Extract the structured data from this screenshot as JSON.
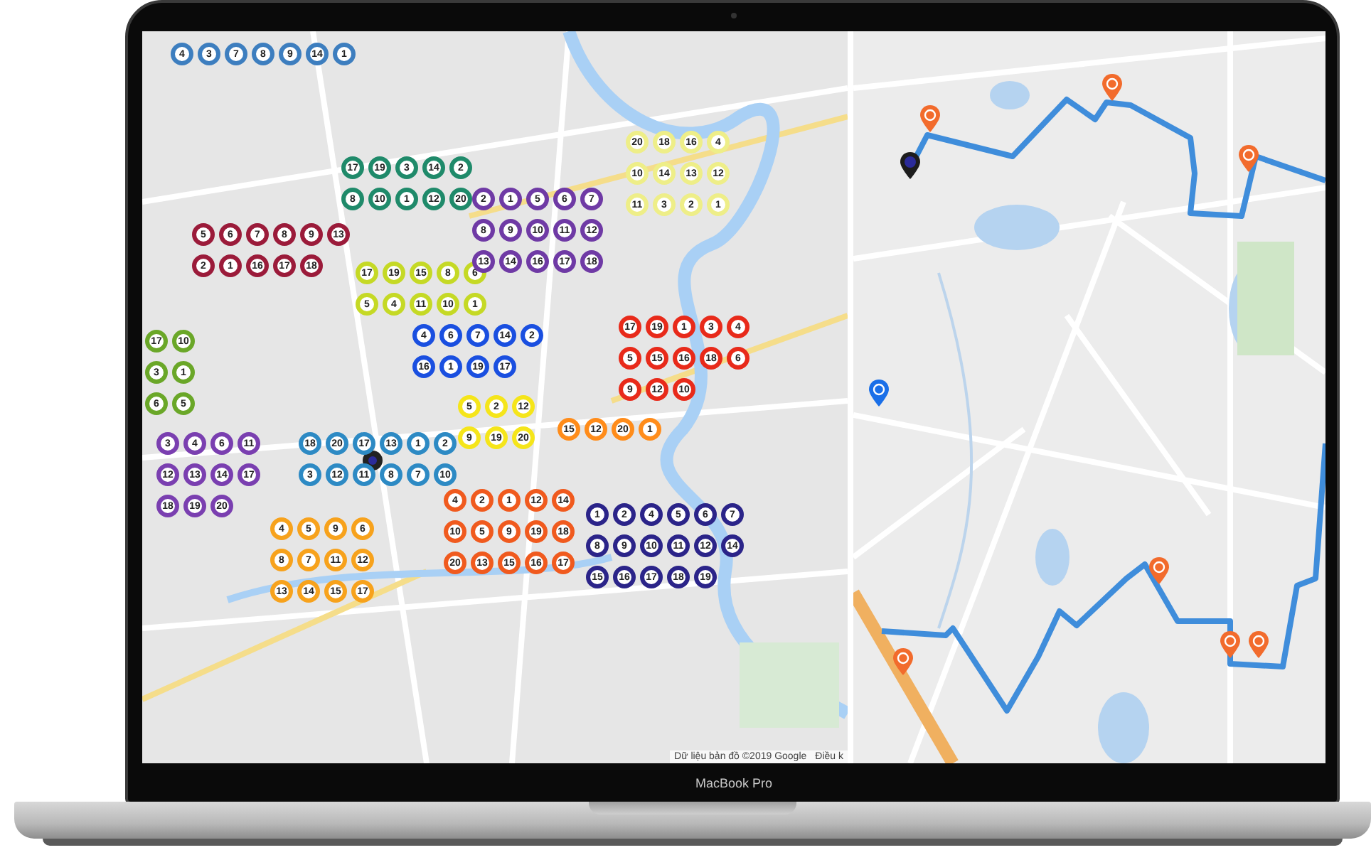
{
  "left_map": {
    "routes": [
      {
        "color": "#3d7ebf",
        "stops": [
          "4",
          "3",
          "7",
          "8",
          "9",
          "14",
          "1"
        ]
      },
      {
        "color": "#1f8a6a",
        "stops": [
          "17",
          "19",
          "3",
          "14",
          "2",
          "8",
          "10",
          "1",
          "12",
          "20"
        ]
      },
      {
        "color": "#9b1b3a",
        "stops": [
          "5",
          "6",
          "7",
          "8",
          "9",
          "13",
          "2",
          "1",
          "16",
          "17",
          "18"
        ]
      },
      {
        "color": "#6aa728",
        "stops": [
          "17",
          "10",
          "3",
          "1",
          "6",
          "5"
        ]
      },
      {
        "color": "#c5d925",
        "stops": [
          "17",
          "19",
          "15",
          "8",
          "6",
          "5",
          "4",
          "11",
          "10",
          "1"
        ]
      },
      {
        "color": "#6f3aa5",
        "stops": [
          "2",
          "1",
          "5",
          "6",
          "7",
          "8",
          "9",
          "10",
          "11",
          "12",
          "13",
          "14",
          "16",
          "17",
          "18"
        ]
      },
      {
        "color": "#eeee88",
        "stops": [
          "20",
          "18",
          "16",
          "4",
          "10",
          "14",
          "13",
          "12",
          "11",
          "3",
          "2",
          "1"
        ]
      },
      {
        "color": "#1a4fe0",
        "stops": [
          "4",
          "6",
          "7",
          "14",
          "2",
          "16",
          "1",
          "19",
          "17"
        ]
      },
      {
        "color": "#e82a1a",
        "stops": [
          "17",
          "19",
          "1",
          "3",
          "4",
          "5",
          "15",
          "16",
          "18",
          "6",
          "9",
          "12",
          "10"
        ]
      },
      {
        "color": "#2d8ac4",
        "stops": [
          "18",
          "20",
          "17",
          "13",
          "1",
          "2",
          "3",
          "12",
          "11",
          "8",
          "7",
          "10"
        ]
      },
      {
        "color": "#f5e51a",
        "stops": [
          "5",
          "2",
          "12",
          "9",
          "19",
          "20"
        ]
      },
      {
        "color": "#f05a1e",
        "stops": [
          "4",
          "2",
          "1",
          "12",
          "14",
          "10",
          "5",
          "9",
          "19",
          "18",
          "20",
          "13",
          "15",
          "16",
          "17"
        ]
      },
      {
        "color": "#ff8c1a",
        "stops": [
          "15",
          "12",
          "20",
          "1"
        ]
      },
      {
        "color": "#f7a21c",
        "stops": [
          "4",
          "5",
          "9",
          "6",
          "8",
          "7",
          "11",
          "12",
          "13",
          "14",
          "15",
          "17"
        ]
      },
      {
        "color": "#7a3fb0",
        "stops": [
          "3",
          "4",
          "6",
          "11",
          "12",
          "13",
          "14",
          "17",
          "18",
          "19",
          "20"
        ]
      },
      {
        "color": "#2b2489",
        "stops": [
          "1",
          "2",
          "4",
          "5",
          "6",
          "7",
          "8",
          "9",
          "10",
          "11",
          "12",
          "14",
          "15",
          "16",
          "17",
          "18",
          "19"
        ]
      }
    ],
    "attribution": [
      "Dữ liệu bản đồ ©2019 Google",
      "Điều k"
    ]
  },
  "device_label": "MacBook Pro"
}
